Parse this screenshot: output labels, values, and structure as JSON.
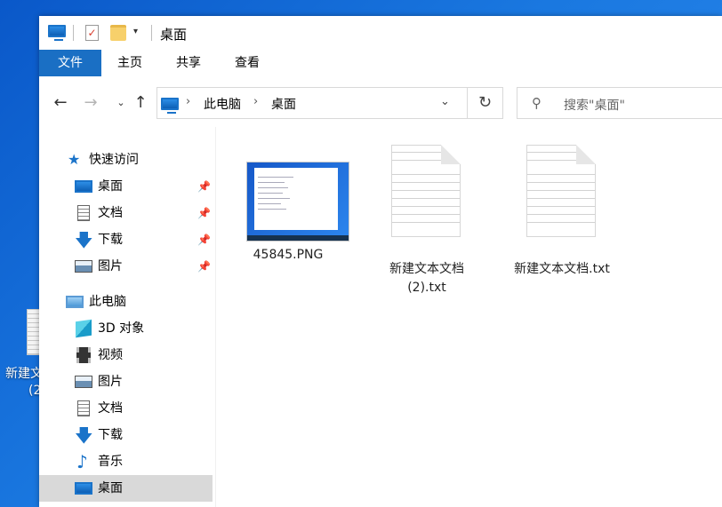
{
  "desktop": {
    "icon_label_line1": "新建文",
    "icon_label_line2": "(2"
  },
  "window": {
    "title": "桌面",
    "quick_access_dropdown": "▾",
    "tabs": [
      {
        "label": "文件",
        "active": true
      },
      {
        "label": "主页"
      },
      {
        "label": "共享"
      },
      {
        "label": "查看"
      }
    ]
  },
  "address": {
    "crumbs": [
      "此电脑",
      "桌面"
    ],
    "search_placeholder": "搜索\"桌面\""
  },
  "nav": {
    "quick_access": "快速访问",
    "qa_items": [
      "桌面",
      "文档",
      "下载",
      "图片"
    ],
    "this_pc": "此电脑",
    "pc_items": [
      "3D 对象",
      "视频",
      "图片",
      "文档",
      "下载",
      "音乐",
      "桌面"
    ]
  },
  "files": [
    {
      "name": "45845.PNG",
      "type": "image"
    },
    {
      "name": "新建文本文档\n(2).txt",
      "type": "text"
    },
    {
      "name": "新建文本文档.txt",
      "type": "text"
    }
  ],
  "colors": {
    "accent": "#1a6fc4",
    "selection": "#d9d9d9",
    "desktop": "#1a78e0"
  }
}
